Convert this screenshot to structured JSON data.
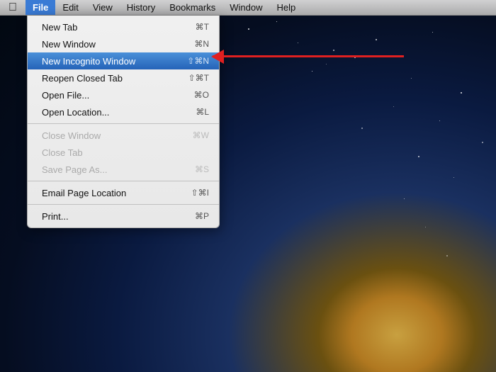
{
  "desktop": {
    "bg_description": "macOS mountain starfield wallpaper"
  },
  "menubar": {
    "apple_label": "",
    "items": [
      {
        "id": "apple",
        "label": "⌘",
        "active": false,
        "bold": false
      },
      {
        "id": "file",
        "label": "File",
        "active": true,
        "bold": true
      },
      {
        "id": "edit",
        "label": "Edit",
        "active": false,
        "bold": false
      },
      {
        "id": "view",
        "label": "View",
        "active": false,
        "bold": false
      },
      {
        "id": "history",
        "label": "History",
        "active": false,
        "bold": false
      },
      {
        "id": "bookmarks",
        "label": "Bookmarks",
        "active": false,
        "bold": false
      },
      {
        "id": "window",
        "label": "Window",
        "active": false,
        "bold": false
      },
      {
        "id": "help",
        "label": "Help",
        "active": false,
        "bold": false
      }
    ]
  },
  "dropdown": {
    "items": [
      {
        "id": "new-tab",
        "label": "New Tab",
        "shortcut": "⌘T",
        "disabled": false,
        "highlighted": false,
        "separator_after": false
      },
      {
        "id": "new-window",
        "label": "New Window",
        "shortcut": "⌘N",
        "disabled": false,
        "highlighted": false,
        "separator_after": false
      },
      {
        "id": "new-incognito-window",
        "label": "New Incognito Window",
        "shortcut": "⇧⌘N",
        "disabled": false,
        "highlighted": true,
        "separator_after": false
      },
      {
        "id": "reopen-closed-tab",
        "label": "Reopen Closed Tab",
        "shortcut": "⇧⌘T",
        "disabled": false,
        "highlighted": false,
        "separator_after": false
      },
      {
        "id": "open-file",
        "label": "Open File...",
        "shortcut": "⌘O",
        "disabled": false,
        "highlighted": false,
        "separator_after": false
      },
      {
        "id": "open-location",
        "label": "Open Location...",
        "shortcut": "⌘L",
        "disabled": false,
        "highlighted": false,
        "separator_after": true
      },
      {
        "id": "close-window",
        "label": "Close Window",
        "shortcut": "⌘W",
        "disabled": true,
        "highlighted": false,
        "separator_after": false
      },
      {
        "id": "close-tab",
        "label": "Close Tab",
        "shortcut": "",
        "disabled": true,
        "highlighted": false,
        "separator_after": false
      },
      {
        "id": "save-page-as",
        "label": "Save Page As...",
        "shortcut": "⌘S",
        "disabled": true,
        "highlighted": false,
        "separator_after": true
      },
      {
        "id": "email-page-location",
        "label": "Email Page Location",
        "shortcut": "⇧⌘I",
        "disabled": false,
        "highlighted": false,
        "separator_after": true
      },
      {
        "id": "print",
        "label": "Print...",
        "shortcut": "⌘P",
        "disabled": false,
        "highlighted": false,
        "separator_after": false
      }
    ]
  },
  "arrow": {
    "color": "#e02020"
  }
}
